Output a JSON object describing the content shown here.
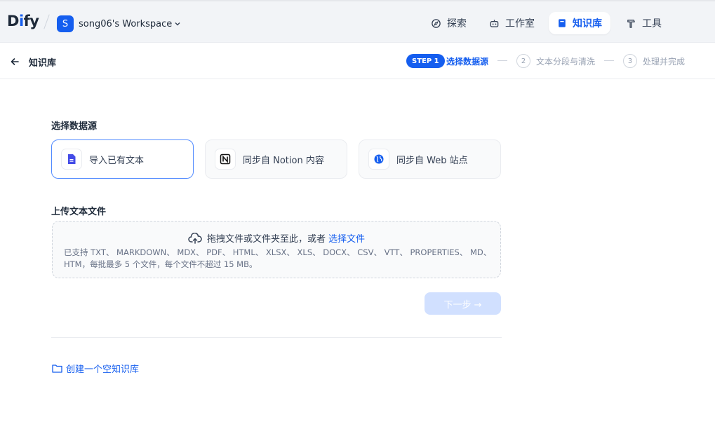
{
  "app": {
    "logo_prefix": "D",
    "logo_i": "i",
    "logo_suffix": "fy"
  },
  "workspace": {
    "avatar_letter": "S",
    "name": "song06's Workspace"
  },
  "nav": [
    {
      "label": "探索",
      "icon": "compass-icon"
    },
    {
      "label": "工作室",
      "icon": "robot-icon"
    },
    {
      "label": "知识库",
      "icon": "book-icon",
      "active": true
    },
    {
      "label": "工具",
      "icon": "hammer-icon"
    }
  ],
  "subheader": {
    "back_label": "知识库",
    "steps": [
      {
        "badge": "STEP 1",
        "label": "选择数据源",
        "active": true
      },
      {
        "badge": "2",
        "label": "文本分段与清洗"
      },
      {
        "badge": "3",
        "label": "处理并完成"
      }
    ]
  },
  "main": {
    "source_title": "选择数据源",
    "sources": [
      {
        "label": "导入已有文本",
        "icon": "file-icon",
        "selected": true
      },
      {
        "label": "同步自 Notion 内容",
        "icon": "notion-icon"
      },
      {
        "label": "同步自 Web 站点",
        "icon": "globe-icon"
      }
    ],
    "upload_title": "上传文本文件",
    "dropzone": {
      "text": "拖拽文件或文件夹至此，或者",
      "link": "选择文件",
      "tip": "已支持 TXT、 MARKDOWN、 MDX、 PDF、 HTML、 XLSX、 XLS、 DOCX、 CSV、 VTT、 PROPERTIES、 MD、 HTM，每批最多 5 个文件，每个文件不超过 15 MB。"
    },
    "next_label": "下一步 →",
    "create_empty_label": "创建一个空知识库"
  },
  "colors": {
    "accent": "#155eef",
    "disabled_button": "#d1e0ff"
  }
}
